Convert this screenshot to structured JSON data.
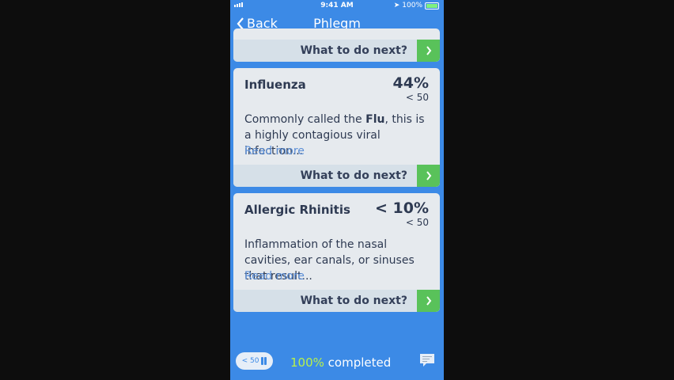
{
  "status_bar": {
    "time": "9:41 AM",
    "battery": "100%"
  },
  "nav": {
    "back_label": "Back",
    "title": "Phlegm"
  },
  "cards": [
    {
      "next_label": "What to do next?"
    },
    {
      "name": "Influenza",
      "percent": "44%",
      "age": "< 50",
      "description_before": "Commonly called the ",
      "description_bold": "Flu",
      "description_after": ", this is a highly contagious viral infection...",
      "read_more": "Read more",
      "next_label": "What to do next?"
    },
    {
      "name": "Allergic Rhinitis",
      "percent": "< 10%",
      "age": "< 50",
      "description": "Inflammation of the nasal cavities, ear canals, or sinuses that result...",
      "read_more": "Read more",
      "next_label": "What to do next?"
    }
  ],
  "bottom_bar": {
    "age_filter": "< 50",
    "progress_percent": "100%",
    "progress_label": "completed"
  },
  "colors": {
    "background": "#3c8ae6",
    "accent_green": "#59c25a",
    "progress_green": "#b8f14a"
  }
}
